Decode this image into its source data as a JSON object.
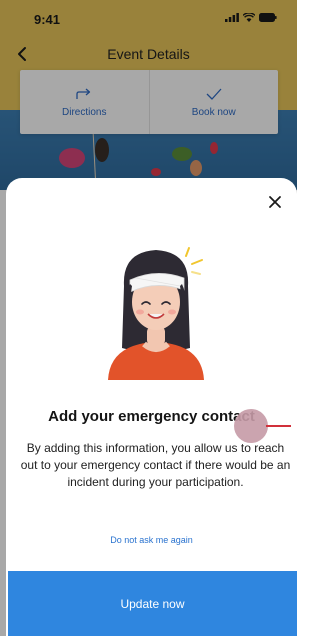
{
  "status_bar": {
    "time": "9:41"
  },
  "nav": {
    "title": "Event Details"
  },
  "actions": [
    {
      "label": "Directions",
      "icon": "directions-icon"
    },
    {
      "label": "Book now",
      "icon": "checkmark-icon"
    }
  ],
  "modal": {
    "heading": "Add your emergency contact",
    "body": "By adding this information, you allow us to reach out to your emergency contact if there would be an incident during your participation.",
    "skip_label": "Do not ask me again",
    "cta_label": "Update now"
  },
  "colors": {
    "header_bg": "#e8c65a",
    "accent": "#2f86df",
    "link": "#2a73cf",
    "avatar_shirt": "#e2532a"
  }
}
